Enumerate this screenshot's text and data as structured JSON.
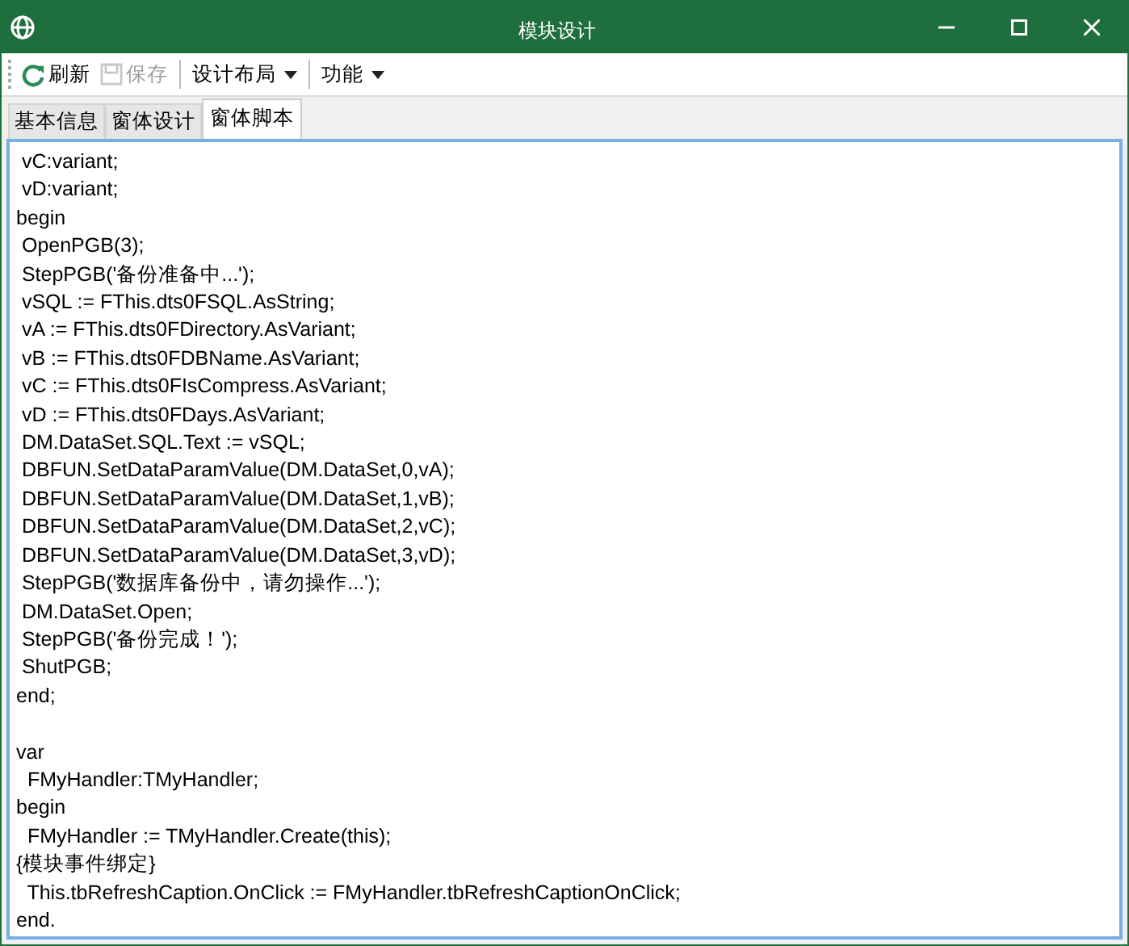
{
  "window": {
    "title": "模块设计"
  },
  "toolbar": [
    {
      "kind": "refresh",
      "label": "刷新",
      "disabled": false,
      "dropdown": false
    },
    {
      "kind": "save",
      "label": "保存",
      "disabled": true,
      "dropdown": false
    },
    {
      "kind": "text",
      "label": "设计布局",
      "disabled": false,
      "dropdown": true
    },
    {
      "kind": "text",
      "label": "功能",
      "disabled": false,
      "dropdown": true
    }
  ],
  "tabs": [
    {
      "label": "基本信息",
      "selected": false
    },
    {
      "label": "窗体设计",
      "selected": false
    },
    {
      "label": "窗体脚本",
      "selected": true
    }
  ],
  "editor": {
    "lines": [
      {
        "text": " vC:variant;"
      },
      {
        "text": " vD:variant;"
      },
      {
        "text": "begin"
      },
      {
        "text": " OpenPGB(3);"
      },
      {
        "text": " StepPGB('备份准备中...');"
      },
      {
        "text": " vSQL := FThis.dts0FSQL.AsString;"
      },
      {
        "text": " vA := FThis.dts0FDirectory.AsVariant;"
      },
      {
        "text": " vB := FThis.dts0FDBName.AsVariant;"
      },
      {
        "text": " vC := FThis.dts0FIsCompress.AsVariant;"
      },
      {
        "text": " vD := FThis.dts0FDays.AsVariant;"
      },
      {
        "text": " DM.DataSet.SQL.Text := vSQL;"
      },
      {
        "text": " DBFUN.SetDataParamValue(DM.DataSet,0,vA);"
      },
      {
        "text": " DBFUN.SetDataParamValue(DM.DataSet,1,vB);"
      },
      {
        "text": " DBFUN.SetDataParamValue(DM.DataSet,2,vC);"
      },
      {
        "text": " DBFUN.SetDataParamValue(DM.DataSet,3,vD);"
      },
      {
        "text": " StepPGB('数据库备份中，请勿操作...');"
      },
      {
        "text": " DM.DataSet.Open;"
      },
      {
        "text": " StepPGB('备份完成！');"
      },
      {
        "text": " ShutPGB;"
      },
      {
        "text": "end;"
      },
      {
        "text": "var",
        "blank_before": true
      },
      {
        "text": "  FMyHandler:TMyHandler;"
      },
      {
        "text": "begin"
      },
      {
        "text": "  FMyHandler := TMyHandler.Create(this);"
      },
      {
        "text": "{模块事件绑定}"
      },
      {
        "text": "  This.tbRefreshCaption.OnClick := FMyHandler.tbRefreshCaptionOnClick;"
      },
      {
        "text": "end."
      }
    ]
  }
}
